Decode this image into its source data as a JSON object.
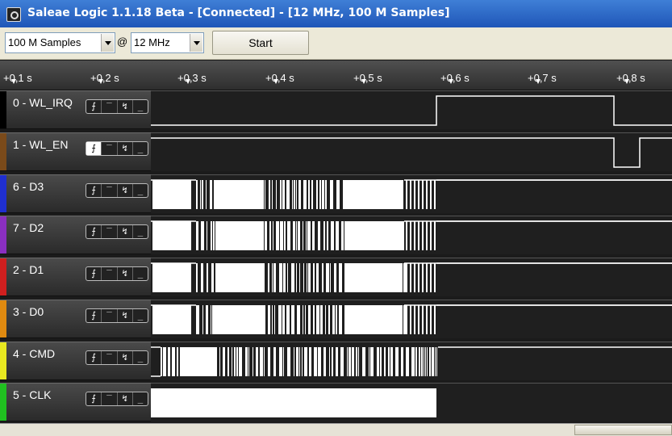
{
  "window": {
    "title": "Saleae Logic 1.1.18 Beta - [Connected] - [12 MHz, 100 M Samples]"
  },
  "toolbar": {
    "samples": "100 M Samples",
    "at": "@",
    "rate": "12 MHz",
    "start_label": "Start"
  },
  "timeline": {
    "ticks": [
      "+0,1 s",
      "+0,2 s",
      "+0,3 s",
      "+0,4 s",
      "+0,5 s",
      "+0,6 s",
      "+0,7 s",
      "+0,8 s"
    ]
  },
  "trigger_glyphs": [
    "⨍",
    "‾",
    "↯",
    "_"
  ],
  "channels": [
    {
      "name": "0 - WL_IRQ",
      "color": "#000000"
    },
    {
      "name": "1 - WL_EN",
      "color": "#7a4a1a"
    },
    {
      "name": "6 - D3",
      "color": "#1f2fd0"
    },
    {
      "name": "7 - D2",
      "color": "#8a2fc0"
    },
    {
      "name": "2 - D1",
      "color": "#d01f1f"
    },
    {
      "name": "3 - D0",
      "color": "#e08a10"
    },
    {
      "name": "4 - CMD",
      "color": "#e8e820"
    },
    {
      "name": "5 - CLK",
      "color": "#20c020"
    }
  ],
  "colors": {
    "wave": "#ffffff",
    "background": "#1f1f1f",
    "accent": "#2a62c6"
  }
}
